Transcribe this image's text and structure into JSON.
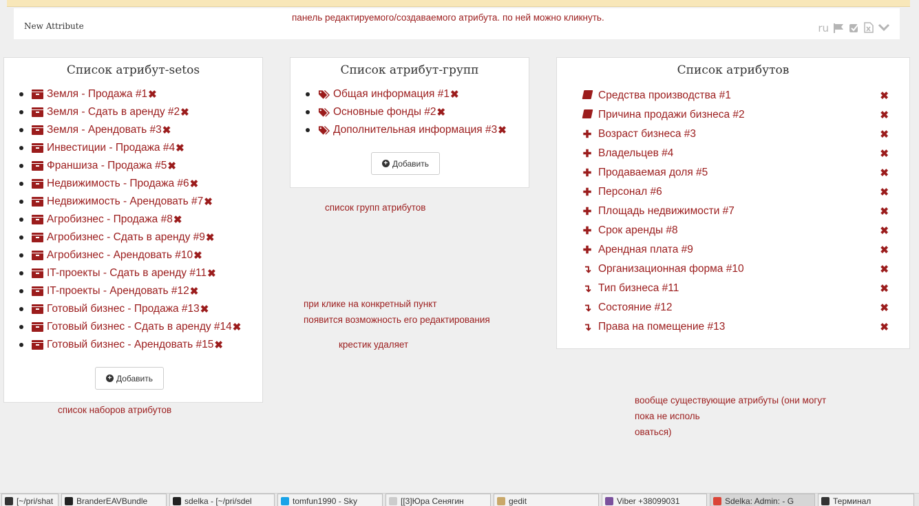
{
  "attribute_panel": {
    "title": "New Attribute",
    "lang": "ru",
    "tools": [
      "flag-icon",
      "check-square-icon",
      "excel-file-icon",
      "chevron-down-icon"
    ]
  },
  "notes": {
    "panel": "панель редактируемого/создаваемого атрибута. по ней можно кликнуть.",
    "groups": "список групп атрибутов",
    "click_line1": "при клике на конкретный пункт",
    "click_line2": "появится возможность его редактирования",
    "cross": "крестик удаляет",
    "sets": "список наборов атрибутов",
    "attrs_line1": "вообще существующие атрибуты (они могут",
    "attrs_line2": "пока не исполь",
    "attrs_line3": "оваться)"
  },
  "sets_panel": {
    "title": "Список атрибут-setos",
    "items": [
      "Земля - Продажа #1",
      "Земля - Сдать в аренду #2",
      "Земля - Арендовать #3",
      "Инвестиции - Продажа #4",
      "Франшиза - Продажа #5",
      "Недвижимость - Продажа #6",
      "Недвижимость - Арендовать #7",
      "Агробизнес - Продажа #8",
      "Агробизнес - Сдать в аренду #9",
      "Агробизнес - Арендовать #10",
      "IT-проекты - Сдать в аренду #11",
      "IT-проекты - Арендовать #12",
      "Готовый бизнес - Продажа #13",
      "Готовый бизнес - Сдать в аренду #14",
      "Готовый бизнес - Арендовать #15"
    ],
    "add_label": "Добавить"
  },
  "groups_panel": {
    "title": "Список атрибут-групп",
    "items": [
      "Общая информация #1",
      "Основные фонды #2",
      "Дополнительная информация #3"
    ],
    "add_label": "Добавить"
  },
  "attrs_panel": {
    "title": "Список атрибутов",
    "items": [
      {
        "label": "Средства производства #1",
        "icon": "book-icon"
      },
      {
        "label": "Причина продажи бизнеса #2",
        "icon": "book-icon"
      },
      {
        "label": "Возраст бизнеса #3",
        "icon": "plus-icon"
      },
      {
        "label": "Владельцев #4",
        "icon": "plus-icon"
      },
      {
        "label": "Продаваемая доля #5",
        "icon": "plus-icon"
      },
      {
        "label": "Персонал #6",
        "icon": "plus-icon"
      },
      {
        "label": "Площадь недвижимости #7",
        "icon": "plus-icon"
      },
      {
        "label": "Срок аренды #8",
        "icon": "plus-icon"
      },
      {
        "label": "Арендная плата #9",
        "icon": "plus-icon"
      },
      {
        "label": "Организационная форма #10",
        "icon": "level-down-icon"
      },
      {
        "label": "Тип бизнеса #11",
        "icon": "level-down-icon"
      },
      {
        "label": "Состояние #12",
        "icon": "level-down-icon"
      },
      {
        "label": "Права на помещение #13",
        "icon": "level-down-icon"
      }
    ]
  },
  "taskbar": {
    "items": [
      {
        "label": "[~/pri/shat",
        "icon": "terminal-icon"
      },
      {
        "label": "BranderEAVBundle",
        "icon": "intellij-icon"
      },
      {
        "label": "sdelka - [~/pri/sdel",
        "icon": "intellij-icon"
      },
      {
        "label": "tomfun1990 - Sky",
        "icon": "skype-icon"
      },
      {
        "label": "[[3]Юра Сенягин",
        "icon": "chat-icon"
      },
      {
        "label": "gedit",
        "icon": "gedit-icon"
      },
      {
        "label": "Viber +38099031",
        "icon": "viber-icon"
      },
      {
        "label": "Sdelka: Admin: - G",
        "icon": "chrome-icon",
        "active": true
      },
      {
        "label": "Терминал",
        "icon": "terminal-icon"
      }
    ]
  },
  "colors": {
    "accent": "#9b1c1c",
    "note": "#9b1c1c",
    "background": "#efefef",
    "top_strip": "#f8e7b9"
  }
}
